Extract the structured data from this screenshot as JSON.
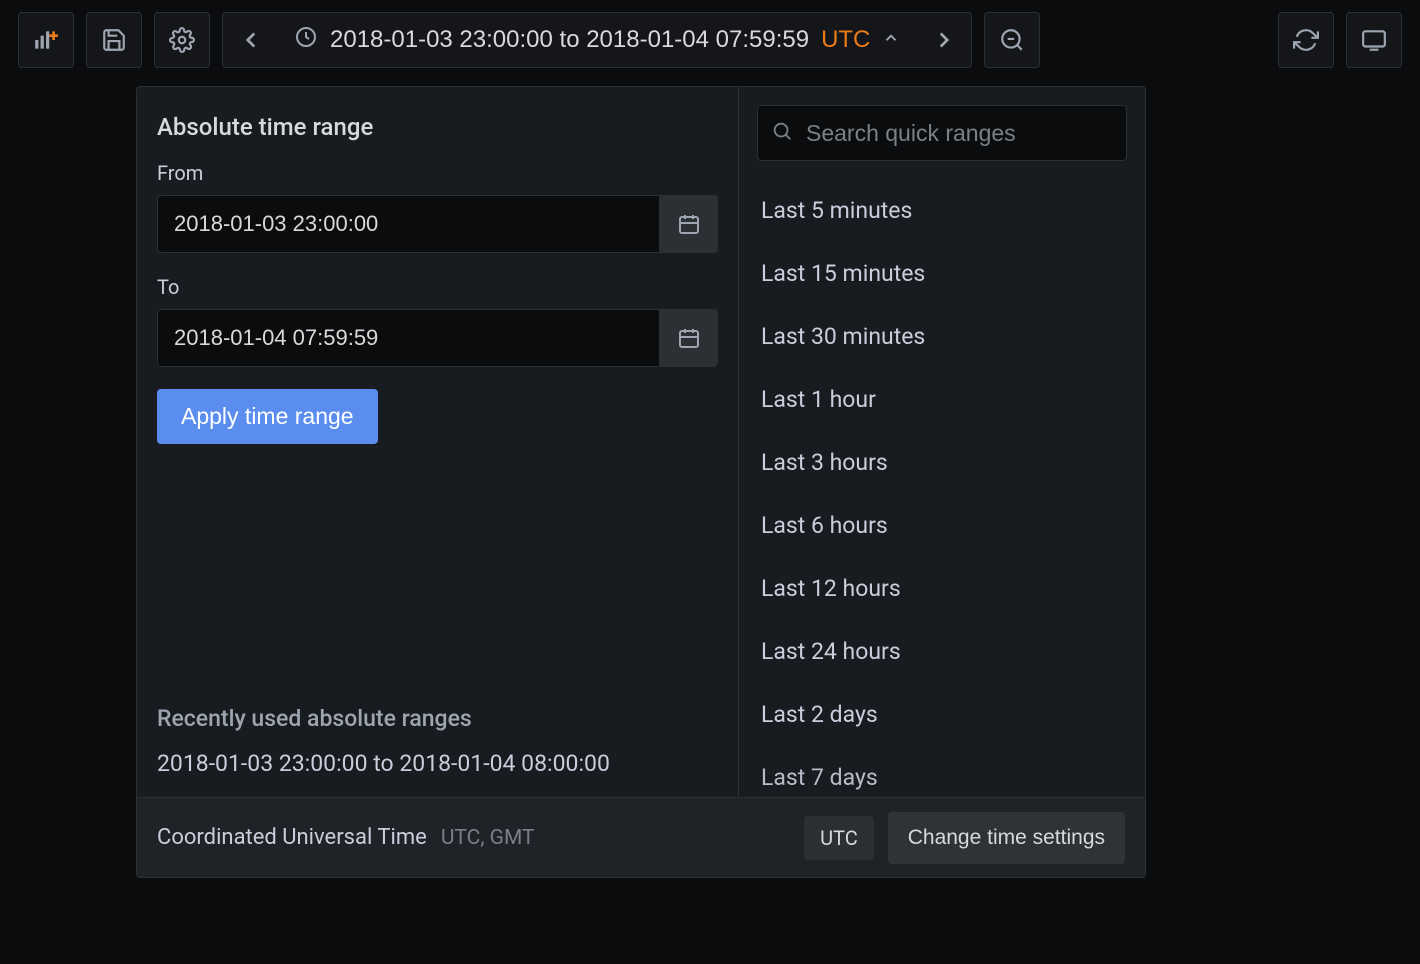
{
  "toolbar": {
    "range_text": "2018-01-03 23:00:00 to 2018-01-04 07:59:59",
    "tz": "UTC"
  },
  "absolute": {
    "title": "Absolute time range",
    "from_label": "From",
    "from_value": "2018-01-03 23:00:00",
    "to_label": "To",
    "to_value": "2018-01-04 07:59:59",
    "apply_label": "Apply time range"
  },
  "recent": {
    "title": "Recently used absolute ranges",
    "items": [
      "2018-01-03 23:00:00 to 2018-01-04 08:00:00"
    ]
  },
  "search": {
    "placeholder": "Search quick ranges"
  },
  "quick_ranges": [
    "Last 5 minutes",
    "Last 15 minutes",
    "Last 30 minutes",
    "Last 1 hour",
    "Last 3 hours",
    "Last 6 hours",
    "Last 12 hours",
    "Last 24 hours",
    "Last 2 days",
    "Last 7 days"
  ],
  "footer": {
    "tz_name": "Coordinated Universal Time",
    "tz_sub": "UTC, GMT",
    "badge": "UTC",
    "change_label": "Change time settings"
  }
}
